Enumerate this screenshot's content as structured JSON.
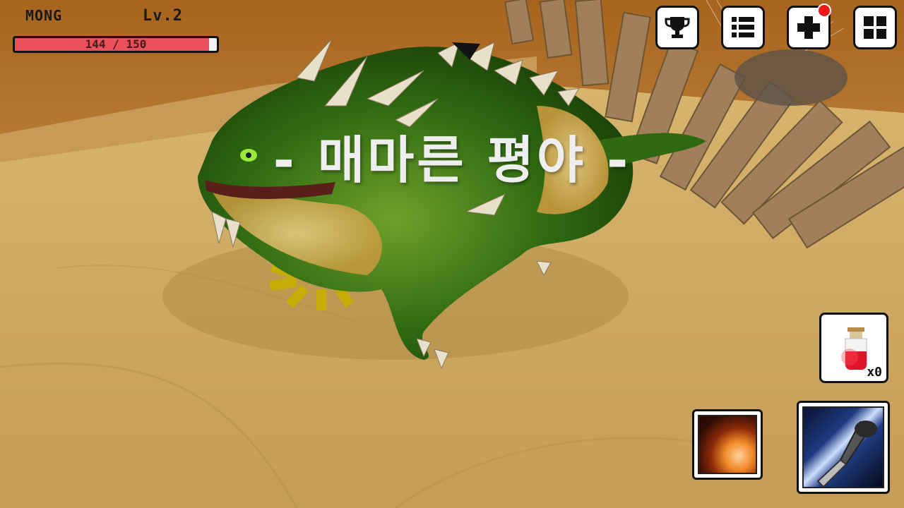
{
  "player": {
    "name": "MONG",
    "level_label": "Lv.2",
    "hp_current": 144,
    "hp_max": 150,
    "hp_text": "144 / 150"
  },
  "top_buttons": [
    {
      "icon": "trophy-icon"
    },
    {
      "icon": "list-icon"
    },
    {
      "icon": "plus-icon",
      "has_notification": true
    },
    {
      "icon": "grid-icon"
    }
  ],
  "monster_title": "- 매마른 평야 -",
  "potion": {
    "icon": "potion-icon",
    "count_label": "x0"
  },
  "skills": [
    {
      "icon": "fire-swirl-skill-icon"
    },
    {
      "icon": "sword-slash-skill-icon"
    }
  ],
  "colors": {
    "hp_fill": "#e8505a",
    "notification": "#f01818",
    "title_text": "#eeeeee"
  }
}
